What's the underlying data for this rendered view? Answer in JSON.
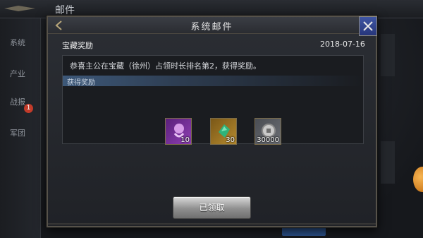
{
  "background": {
    "title": "邮件",
    "sidebar": [
      {
        "label": "系统"
      },
      {
        "label": "产业"
      },
      {
        "label": "战报",
        "badge": "1"
      },
      {
        "label": "军团"
      }
    ]
  },
  "modal": {
    "title": "系统邮件",
    "subject": "宝藏奖励",
    "date": "2018-07-16",
    "body": "恭喜主公在宝藏（徐州）占领时长排名第2，获得奖励。",
    "reward_label": "获得奖励",
    "rewards": [
      {
        "icon": "purple-scroll-icon",
        "count": "10"
      },
      {
        "icon": "green-jade-icon",
        "count": "30"
      },
      {
        "icon": "silver-coin-icon",
        "count": "30000"
      }
    ],
    "claim_button": "已领取"
  },
  "colors": {
    "accent_blue": "#3f56a4",
    "modal_bg": "#2b2e34",
    "claimed_button": "#8f8f8f",
    "badge_red": "#c23b2a"
  }
}
